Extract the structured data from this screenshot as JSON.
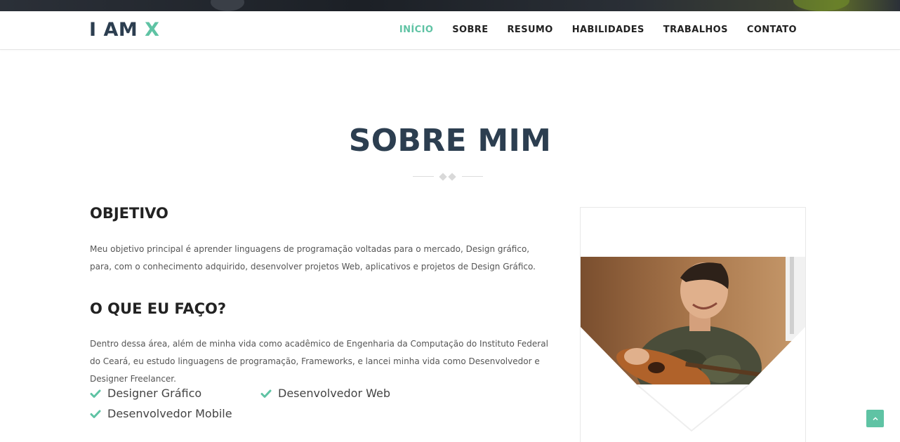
{
  "brand": {
    "logo_main": "I AM",
    "logo_accent": "X",
    "accent_color": "#5fc3a4",
    "dark_color": "#2c3e50"
  },
  "nav": {
    "items": [
      {
        "label": "INÍCIO",
        "active": true
      },
      {
        "label": "SOBRE",
        "active": false
      },
      {
        "label": "RESUMO",
        "active": false
      },
      {
        "label": "HABILIDADES",
        "active": false
      },
      {
        "label": "TRABALHOS",
        "active": false
      },
      {
        "label": "CONTATO",
        "active": false
      }
    ]
  },
  "about": {
    "title": "SOBRE MIM",
    "objective_heading": "OBJETIVO",
    "objective_text": "Meu objetivo principal é aprender linguagens de programação voltadas para o mercado, Design gráfico, para, com o conhecimento adquirido, desenvolver projetos Web, aplicativos e projetos de Design Gráfico.",
    "whatido_heading": "O QUE EU FAÇO?",
    "whatido_text": "Dentro dessa área, além de minha vida como acadêmico de Engenharia da Computação do Instituto Federal do Ceará, eu estudo linguagens de programação, Frameworks, e lancei minha vida como Desenvolvedor e Designer Freelancer.",
    "skills": [
      "Designer Gráfico",
      "Desenvolvedor Web",
      "Desenvolvedor Mobile"
    ]
  },
  "icons": {
    "skill_marker": "check-icon",
    "back_to_top": "chevron-up-icon"
  }
}
